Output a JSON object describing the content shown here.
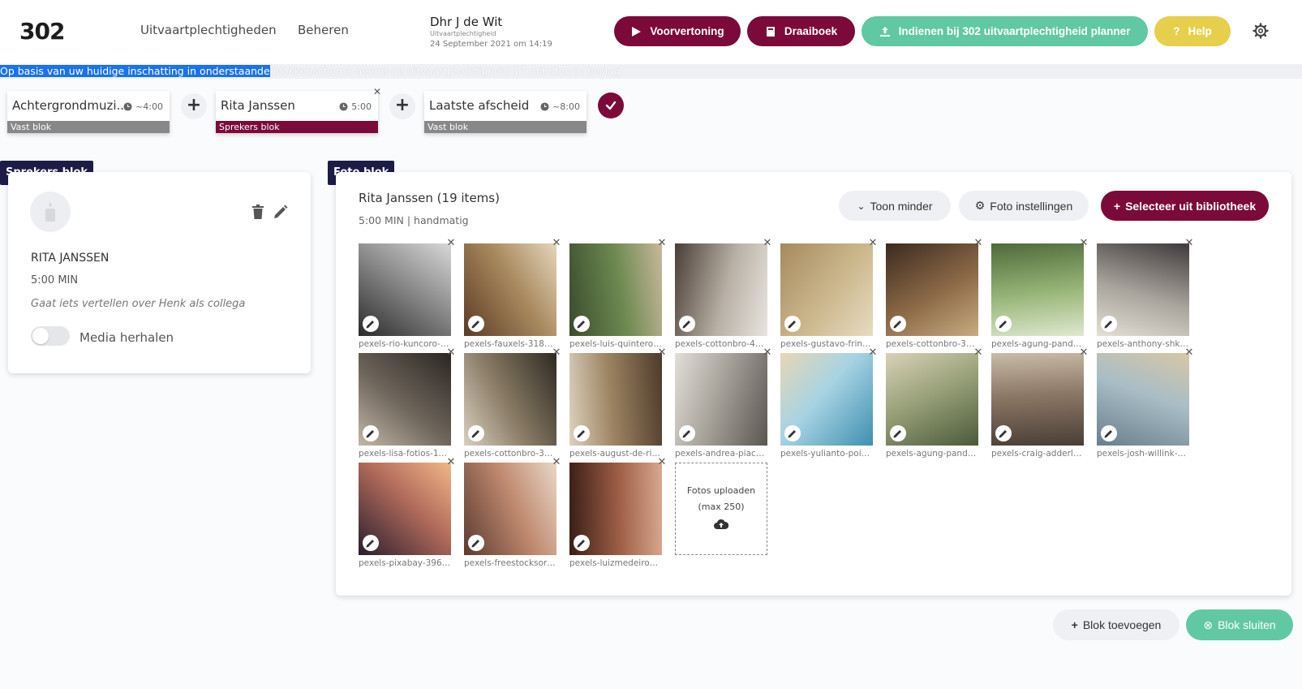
{
  "header": {
    "logo": "302",
    "nav": [
      "Uitvaartplechtigheden",
      "Beheren"
    ],
    "deceased_name": "Dhr J de Wit",
    "deceased_type": "Uitvaartplechtigheid",
    "deceased_date": "24 September 2021 om 14:19",
    "buttons": {
      "preview": "Voorvertoning",
      "script": "Draaiboek",
      "submit": "Indienen bij 302 uitvaartplechtigheid planner",
      "help": "Help"
    },
    "settings_icon": "gear-icon"
  },
  "notice": {
    "highlighted": "Op basis van uw huidige inschatting in onderstaande",
    "rest": " blokkenschema neemt de uitvaartplechtigheid 17 minuten in beslag."
  },
  "schedule": [
    {
      "title": "Achtergrondmuzi...",
      "duration": "~4:00",
      "tag": "Vast blok"
    },
    {
      "title": "Rita Janssen",
      "duration": "5:00",
      "tag": "Sprekers blok"
    },
    {
      "title": "Laatste afscheid",
      "duration": "~8:00",
      "tag": "Vast blok"
    }
  ],
  "speaker_panel": {
    "label": "Sprekers blok",
    "name": "RITA JANSSEN",
    "duration": "5:00 MIN",
    "description": "Gaat iets vertellen over Henk als collega",
    "toggle_label": "Media herhalen"
  },
  "photo_panel": {
    "label": "Foto blok",
    "title": "Rita Janssen (19 items)",
    "subtitle": "5:00 MIN | handmatig",
    "buttons": {
      "show_less": "Toon minder",
      "settings": "Foto instellingen",
      "select": "Selecteer uit bibliotheek"
    },
    "photos": [
      {
        "caption": "pexels-rio-kuncoro-3...",
        "colors": [
          "#2b2b2b",
          "#8c8c8c",
          "#d8d8d8"
        ]
      },
      {
        "caption": "pexels-fauxels-3184...",
        "colors": [
          "#5c3b24",
          "#a8895e",
          "#e5d6bc"
        ]
      },
      {
        "caption": "pexels-luis-quintero-...",
        "colors": [
          "#3a4b2c",
          "#6e8a52",
          "#c8b89a"
        ]
      },
      {
        "caption": "pexels-cottonbro-40...",
        "colors": [
          "#4a3e36",
          "#b9b1a6",
          "#e8e4de"
        ]
      },
      {
        "caption": "pexels-gustavo-fring...",
        "colors": [
          "#a58a5e",
          "#cdb88e",
          "#e6dcc2"
        ]
      },
      {
        "caption": "pexels-cottonbro-31...",
        "colors": [
          "#3c2a1e",
          "#8c6a48",
          "#c9ab80"
        ]
      },
      {
        "caption": "pexels-agung-pandit-...",
        "colors": [
          "#4d6a3a",
          "#9ab77a",
          "#dfe8d0"
        ]
      },
      {
        "caption": "pexels-anthony-shkra...",
        "colors": [
          "#3e3a3c",
          "#a9a49c",
          "#e4e0d6"
        ]
      },
      {
        "caption": "pexels-lisa-fotios-16...",
        "colors": [
          "#2a2622",
          "#6f665c",
          "#c2b7a8"
        ]
      },
      {
        "caption": "pexels-cottonbro-31...",
        "colors": [
          "#2e2a22",
          "#8a7c66",
          "#d9cfc0"
        ]
      },
      {
        "caption": "pexels-august-de-ric...",
        "colors": [
          "#4e3a2a",
          "#9c8462",
          "#ddd1be"
        ]
      },
      {
        "caption": "pexels-andrea-piacqu...",
        "colors": [
          "#5a5650",
          "#a8a49c",
          "#e2dfd8"
        ]
      },
      {
        "caption": "pexels-yulianto-poitie...",
        "colors": [
          "#3f8fb0",
          "#a7d3e3",
          "#e8d6b6"
        ]
      },
      {
        "caption": "pexels-agung-pandit-...",
        "colors": [
          "#4b5a3a",
          "#9aa27a",
          "#d8d2b8"
        ]
      },
      {
        "caption": "pexels-craig-adderley...",
        "colors": [
          "#4a3e36",
          "#8c7866",
          "#c9bca8"
        ]
      },
      {
        "caption": "pexels-josh-willink-1...",
        "colors": [
          "#6a7e8c",
          "#a9bdc6",
          "#d7c7a6"
        ]
      },
      {
        "caption": "pexels-pixabay-3969...",
        "colors": [
          "#2a1e2e",
          "#b06a5a",
          "#f2b78a"
        ]
      },
      {
        "caption": "pexels-freestocksorg-...",
        "colors": [
          "#5c3a30",
          "#c08a70",
          "#e8d8c8"
        ]
      },
      {
        "caption": "pexels-luizmedeirosp...",
        "colors": [
          "#3a1e16",
          "#a06048",
          "#d8a890"
        ]
      }
    ],
    "upload_line1": "Fotos uploaden",
    "upload_line2": "(max 250)"
  },
  "footer": {
    "add_block": "Blok toevoegen",
    "close_block": "Blok sluiten"
  },
  "colors": {
    "brand_maroon": "#7b0a3b",
    "brand_teal": "#61c8a4",
    "brand_yellow": "#e6cf4a",
    "label_navy": "#1c1c46"
  }
}
